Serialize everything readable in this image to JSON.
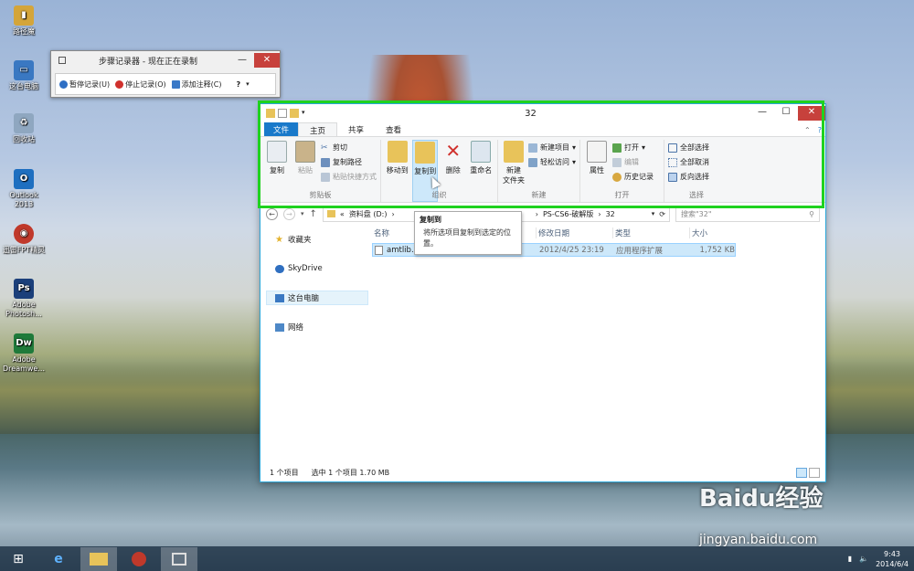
{
  "desktop": {
    "icons": [
      {
        "label": "路径魔",
        "color": "#d4a53a"
      },
      {
        "label": "这台电脑",
        "color": "#3a78c2"
      },
      {
        "label": "回收站",
        "color": "#8fa7c0"
      },
      {
        "label": "Outlook 2013",
        "color": "#1e6fc0"
      },
      {
        "label": "迅雷FPT精灵",
        "color": "#c0392b"
      },
      {
        "label": "Adobe Photosh...",
        "color": "#1b3f7a"
      },
      {
        "label": "Adobe Dreamwe...",
        "color": "#1f7a3a"
      }
    ]
  },
  "psr": {
    "title": "步骤记录器 - 现在正在录制",
    "pause": "暂停记录(U)",
    "stop": "停止记录(O)",
    "comment": "添加注释(C)",
    "help": "?"
  },
  "explorer": {
    "title": "32",
    "tabs": {
      "file": "文件",
      "home": "主页",
      "share": "共享",
      "view": "查看"
    },
    "ribbon": {
      "clipboard": {
        "copy": "复制",
        "paste": "粘贴",
        "cut": "剪切",
        "copy_path": "复制路径",
        "paste_shortcut": "粘贴快捷方式",
        "label": "剪贴板"
      },
      "organize": {
        "move_to": "移动到",
        "copy_to": "复制到",
        "delete": "删除",
        "rename": "重命名",
        "label": "组织"
      },
      "new": {
        "new_folder": "新建\n文件夹",
        "new_item": "新建项目",
        "easy_access": "轻松访问",
        "label": "新建"
      },
      "open": {
        "properties": "属性",
        "open": "打开",
        "edit": "编辑",
        "history": "历史记录",
        "label": "打开"
      },
      "select": {
        "select_all": "全部选择",
        "select_none": "全部取消",
        "invert": "反向选择",
        "label": "选择"
      }
    },
    "address": {
      "crumb1": "资料盘 (D:)",
      "crumb2": "PS-CS6-破解版",
      "crumb3": "32"
    },
    "search_placeholder": "搜索\"32\"",
    "nav": {
      "favorites": "收藏夹",
      "skydrive": "SkyDrive",
      "this_pc": "这台电脑",
      "network": "网络"
    },
    "columns": {
      "name": "名称",
      "date": "修改日期",
      "type": "类型",
      "size": "大小"
    },
    "file": {
      "name": "amtlib.dll",
      "date": "2012/4/25 23:19",
      "type": "应用程序扩展",
      "size": "1,752 KB"
    },
    "status": {
      "count": "1 个项目",
      "selected": "选中 1 个项目  1.70 MB"
    }
  },
  "tooltip": {
    "title": "复制到",
    "body": "将所选项目复制到选定的位置。"
  },
  "watermark": {
    "logo": "Baidu经验",
    "url": "jingyan.baidu.com"
  },
  "taskbar": {
    "time": "9:43",
    "date": "2014/6/4"
  }
}
